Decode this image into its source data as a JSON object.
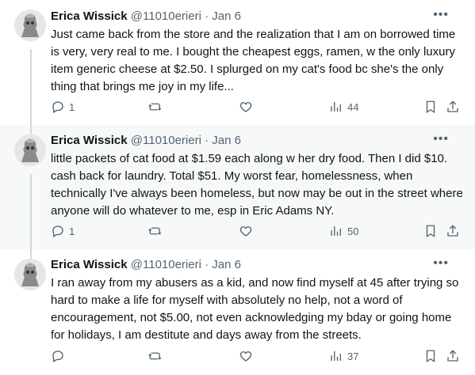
{
  "tweets": [
    {
      "author": "Erica Wissick",
      "handle": "@11010erieri",
      "dot": "·",
      "date": "Jan 6",
      "more": "•••",
      "text": "Just came back from the store and the realization that I am on borrowed time is very, very real to me. I bought the cheapest eggs, ramen, w the only luxury item generic cheese at $2.50. I splurged on my cat's food bc she's the only thing that brings me joy in my life...",
      "replies": "1",
      "views": "44"
    },
    {
      "author": "Erica Wissick",
      "handle": "@11010erieri",
      "dot": "·",
      "date": "Jan 6",
      "more": "•••",
      "text": "little packets of cat food at $1.59 each along w her dry food. Then I did $10. cash back for laundry. Total $51. My worst fear, homelessness, when technically I've always been homeless, but now may be out in the street where anyone will do whatever to me, esp in Eric Adams NY.",
      "replies": "1",
      "views": "50"
    },
    {
      "author": "Erica Wissick",
      "handle": "@11010erieri",
      "dot": "·",
      "date": "Jan 6",
      "more": "•••",
      "text": "I ran away from my abusers as a kid, and now find myself at 45 after trying so hard to make a life for myself with absolutely no help, not a word of encouragement, not $5.00, not even acknowledging my bday or going home for holidays, I am destitute and days away from the streets.",
      "replies": "",
      "views": "37"
    }
  ],
  "icons": {
    "reply": "reply-icon",
    "retweet": "retweet-icon",
    "like": "like-icon",
    "views": "views-icon",
    "bookmark": "bookmark-icon",
    "share": "share-icon"
  },
  "colors": {
    "text": "#0f1419",
    "muted": "#536471",
    "thread_line": "#cfd9de",
    "highlight_bg": "#f7f9f9"
  }
}
